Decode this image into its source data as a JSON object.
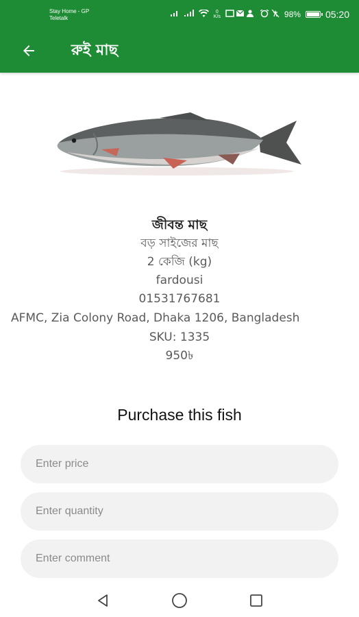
{
  "status_bar": {
    "carrier_line1": "Stay Home - GP",
    "carrier_line2": "Teletalk",
    "battery": "98%",
    "time": "05:20",
    "icons": [
      "signal-icon",
      "wifi-icon",
      "data-speed-icon",
      "notification-icons",
      "alarm-icon",
      "battery-icon"
    ]
  },
  "app_bar": {
    "title": "রুই মাছ",
    "back_icon": "arrow-left-icon"
  },
  "product": {
    "image": "rohu-fish",
    "title": "জীবন্ত মাছ",
    "size": "বড় সাইজের মাছ",
    "weight": "2 কেজি (kg)",
    "seller": "fardousi",
    "phone": "01531767681",
    "address": "AFMC, Zia Colony Road, Dhaka 1206, Bangladesh",
    "sku": "SKU: 1335",
    "price": "950৳"
  },
  "purchase": {
    "heading": "Purchase this fish",
    "price_placeholder": "Enter price",
    "quantity_placeholder": "Enter quantity",
    "comment_placeholder": "Enter comment"
  },
  "colors": {
    "primary": "#1e8b35",
    "field_bg": "#f2f2f2"
  },
  "nav_bar": {
    "icons": [
      "back-triangle-icon",
      "home-circle-icon",
      "recents-square-icon"
    ]
  }
}
